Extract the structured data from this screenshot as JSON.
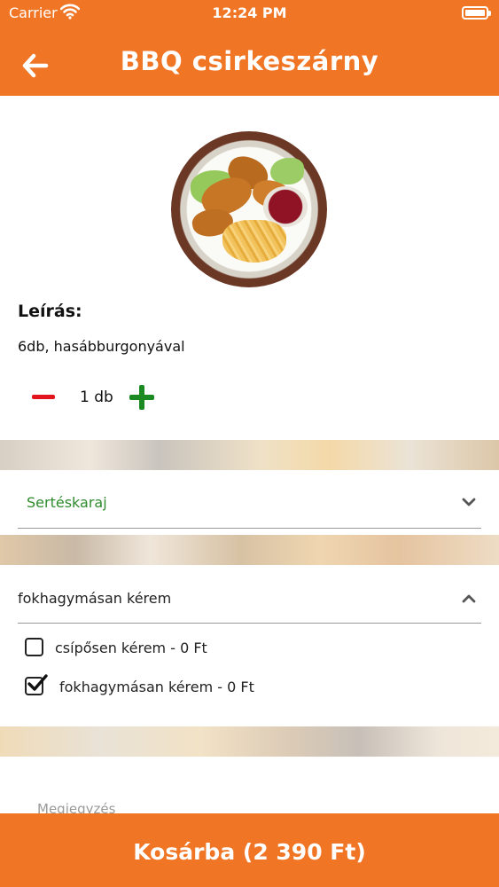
{
  "status_bar": {
    "carrier": "Carrier",
    "time": "12:24 PM"
  },
  "header": {
    "title": "BBQ csirkeszárny",
    "back_icon": "arrow-left-icon"
  },
  "product": {
    "description_label": "Leírás:",
    "description": "6db, hasábburgonyával",
    "quantity": "1 db"
  },
  "selectors": [
    {
      "value": "Sertéskaraj",
      "expanded": false
    },
    {
      "value": "fokhagymásan kérem",
      "expanded": true,
      "options": [
        {
          "label": "csípősen kérem - 0 Ft",
          "checked": false
        },
        {
          "label": "fokhagymásan kérem - 0 Ft",
          "checked": true
        }
      ]
    }
  ],
  "comment": {
    "placeholder": "Megjegyzés"
  },
  "cart_button": {
    "label": "Kosárba (2 390 Ft)"
  },
  "colors": {
    "brand": "#f07524",
    "minus": "#e2141c",
    "plus": "#1b8a22",
    "selected_value": "#2e8b2e"
  }
}
